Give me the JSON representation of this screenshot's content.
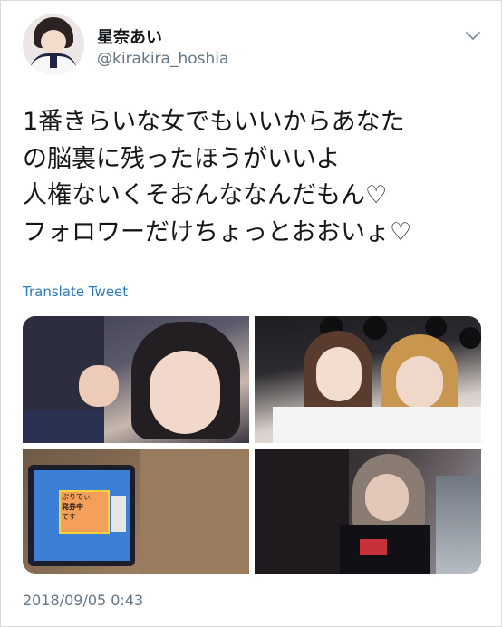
{
  "user": {
    "display_name": "星奈あい",
    "handle": "@kirakira_hoshia"
  },
  "tweet": {
    "lines": [
      "1番きらいな女でもいいからあなた",
      "の脳裏に残ったほうがいいよ",
      "人権ないくそおんななんだもん♡",
      "フォロワーだけちょっとおおいょ♡"
    ],
    "translate_label": "Translate Tweet",
    "timestamp": "2018/09/05 0:43"
  },
  "media": {
    "tiles": [
      {
        "icon": "photo-selfie-girl-dark-hair"
      },
      {
        "icon": "photo-two-people-mouse-ears"
      },
      {
        "icon": "photo-game-screen-station"
      },
      {
        "icon": "photo-two-people-night"
      }
    ],
    "game_screen_text": [
      "ぷりでぃ",
      "発券中",
      "です"
    ]
  },
  "colors": {
    "text": "#14171a",
    "secondary": "#657786",
    "link": "#2b7bb9",
    "border": "#d6dbe0"
  },
  "icons": {
    "menu": "chevron-down-icon",
    "avatar": "avatar"
  }
}
